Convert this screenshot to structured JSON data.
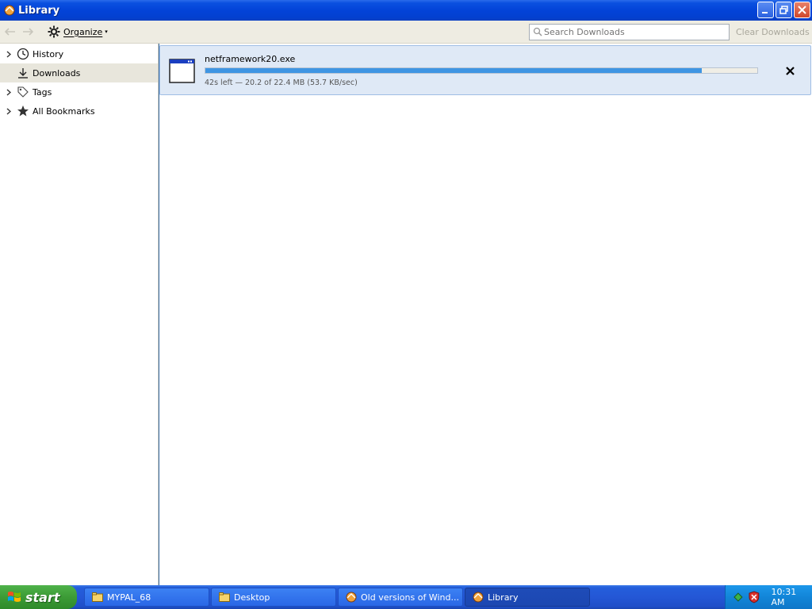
{
  "window": {
    "title": "Library",
    "minimize_label": "_",
    "restore_label": "❐",
    "close_label": "✕"
  },
  "toolbar": {
    "back_glyph": "←",
    "forward_glyph": "→",
    "organize_label": "Organize",
    "organize_caret": "▾",
    "search_placeholder": "Search Downloads",
    "clear_label": "Clear Downloads"
  },
  "sidebar": {
    "items": [
      {
        "label": "History",
        "icon": "clock-icon",
        "expandable": true
      },
      {
        "label": "Downloads",
        "icon": "download-icon",
        "expandable": false,
        "selected": true
      },
      {
        "label": "Tags",
        "icon": "tag-icon",
        "expandable": true
      },
      {
        "label": "All Bookmarks",
        "icon": "star-icon",
        "expandable": true
      }
    ]
  },
  "downloads": [
    {
      "filename": "netframework20.exe",
      "status": "42s left — 20.2 of 22.4 MB (53.7 KB/sec)",
      "progress": 0.9,
      "cancel_glyph": "✕"
    }
  ],
  "taskbar": {
    "start_label": "start",
    "tasks": [
      {
        "label": "MYPAL_68",
        "icon": "folder-icon"
      },
      {
        "label": "Desktop",
        "icon": "folder-icon"
      },
      {
        "label": "Old versions of Wind...",
        "icon": "browser-icon"
      },
      {
        "label": "Library",
        "icon": "browser-icon",
        "active": true
      }
    ],
    "clock": "10:31 AM"
  },
  "colors": {
    "titlebar": "#0343d8",
    "progress_fill": "#3f95e3",
    "selected_row": "#dfe9f6",
    "taskbar": "#245edb",
    "start_button": "#3c9b36"
  }
}
